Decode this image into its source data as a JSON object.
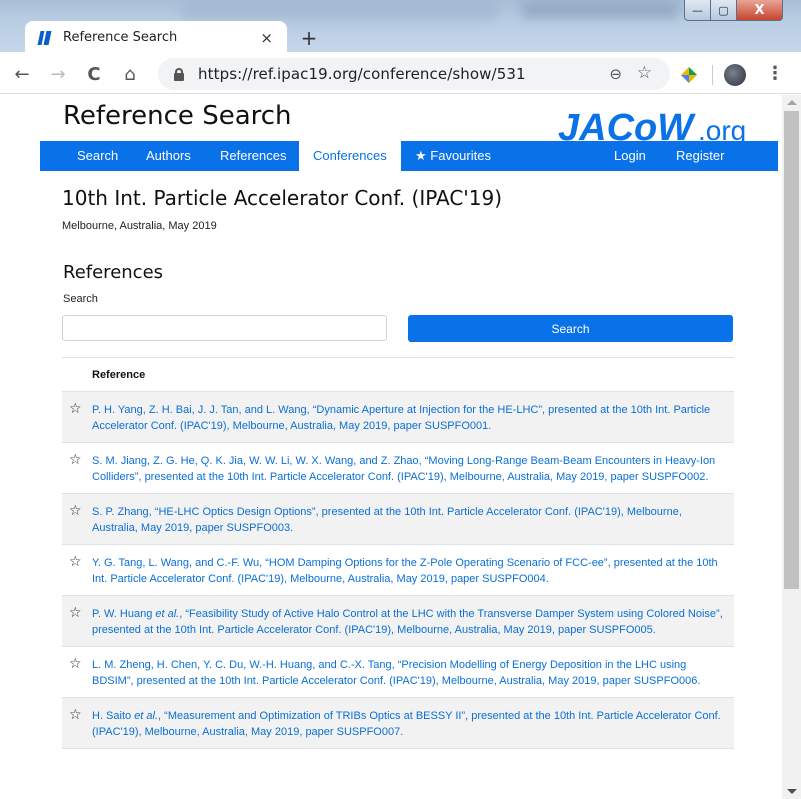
{
  "browser": {
    "tab_title": "Reference Search",
    "tab_close": "×",
    "new_tab": "+",
    "url": "https://ref.ipac19.org/conference/show/531",
    "back": "←",
    "forward": "→",
    "reload": "C",
    "home": "⌂",
    "zoom_icon": "⊖",
    "star_icon": "☆",
    "menu_icon": "⋮",
    "win_min": "—",
    "win_max": "▢",
    "win_close": "X"
  },
  "site": {
    "title": "Reference Search",
    "logo_main": "JACoW",
    "logo_suffix": ".org",
    "nav": [
      {
        "label": "Search"
      },
      {
        "label": "Authors"
      },
      {
        "label": "References"
      },
      {
        "label": "Conferences"
      },
      {
        "label": "Favourites"
      },
      {
        "label": "Login"
      },
      {
        "label": "Register"
      }
    ],
    "active_nav": "Conferences",
    "favourites_icon": "★"
  },
  "conference": {
    "title": "10th Int. Particle Accelerator Conf. (IPAC'19)",
    "subtitle": "Melbourne, Australia, May 2019"
  },
  "references": {
    "heading": "References",
    "search_label": "Search",
    "search_value": "",
    "search_button": "Search",
    "column_header": "Reference",
    "fav_icon": "☆",
    "items": [
      {
        "authors": "P. H. Yang, Z. H. Bai, J. J. Tan, and L. Wang, ",
        "etal": "",
        "rest": "“Dynamic Aperture at Injection for the HE-LHC”, presented at the 10th Int. Particle Accelerator Conf. (IPAC'19), Melbourne, Australia, May 2019, paper SUSPFO001."
      },
      {
        "authors": "S. M. Jiang, Z. G. He, Q. K. Jia, W. W. Li, W. X. Wang, and Z. Zhao, ",
        "etal": "",
        "rest": "“Moving Long-Range Beam-Beam Encounters in Heavy-Ion Colliders”, presented at the 10th Int. Particle Accelerator Conf. (IPAC'19), Melbourne, Australia, May 2019, paper SUSPFO002."
      },
      {
        "authors": "S. P. Zhang, ",
        "etal": "",
        "rest": "“HE-LHC Optics Design Options”, presented at the 10th Int. Particle Accelerator Conf. (IPAC'19), Melbourne, Australia, May 2019, paper SUSPFO003."
      },
      {
        "authors": "Y. G. Tang, L. Wang, and C.-F. Wu, ",
        "etal": "",
        "rest": "“HOM Damping Options for the Z-Pole Operating Scenario of FCC-ee”, presented at the 10th Int. Particle Accelerator Conf. (IPAC'19), Melbourne, Australia, May 2019, paper SUSPFO004."
      },
      {
        "authors": "P. W. Huang ",
        "etal": "et al.",
        "rest": ", “Feasibility Study of Active Halo Control at the LHC with the Transverse Damper System using Colored Noise”, presented at the 10th Int. Particle Accelerator Conf. (IPAC'19), Melbourne, Australia, May 2019, paper SUSPFO005."
      },
      {
        "authors": "L. M. Zheng, H. Chen, Y. C. Du, W.-H. Huang, and C.-X. Tang, ",
        "etal": "",
        "rest": "“Precision Modelling of Energy Deposition in the LHC using BDSIM”, presented at the 10th Int. Particle Accelerator Conf. (IPAC'19), Melbourne, Australia, May 2019, paper SUSPFO006."
      },
      {
        "authors": "H. Saito ",
        "etal": "et al.",
        "rest": ", “Measurement and Optimization of TRIBs Optics at BESSY II”, presented at the 10th Int. Particle Accelerator Conf. (IPAC'19), Melbourne, Australia, May 2019, paper SUSPFO007."
      }
    ]
  },
  "colors": {
    "brand_blue": "#0a72e8",
    "link_blue": "#0a6fd6"
  }
}
